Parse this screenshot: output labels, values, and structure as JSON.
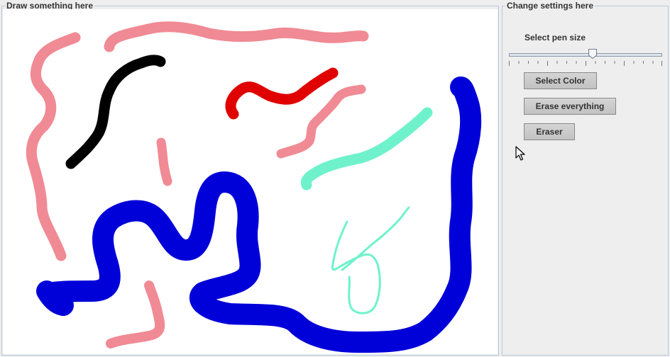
{
  "draw_panel": {
    "title": "Draw something here"
  },
  "settings_panel": {
    "title": "Change settings here",
    "pen_size_label": "Select pen size",
    "pen_size_value": 0.55,
    "buttons": {
      "select_color": "Select Color",
      "erase_everything": "Erase everything",
      "eraser": "Eraser"
    }
  },
  "icons": {
    "cursor": "mouse-pointer-icon"
  },
  "colors": {
    "pink": "#f08a94",
    "black": "#000000",
    "red": "#e00000",
    "mint": "#6ff2cc",
    "blue": "#0000d8"
  }
}
